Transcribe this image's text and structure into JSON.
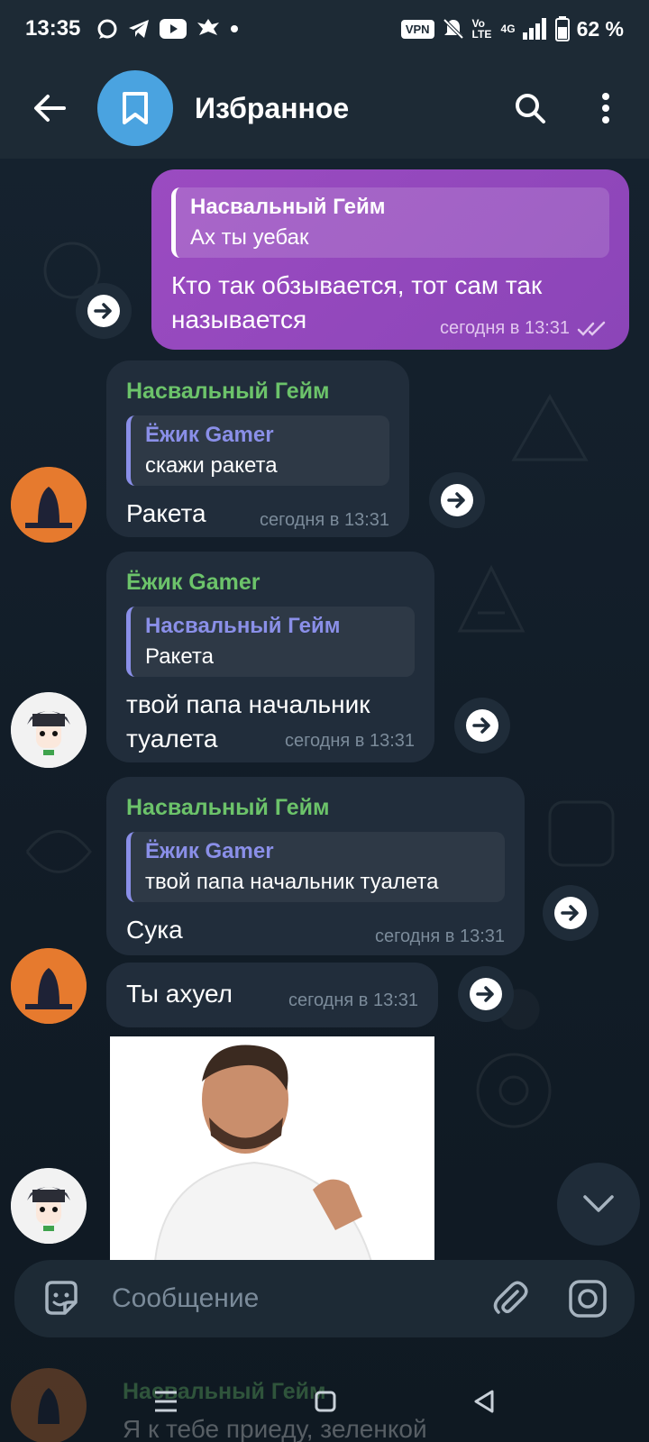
{
  "status_bar": {
    "time": "13:35",
    "vpn_label": "VPN",
    "volte_label": "Vo LTE",
    "network_label": "4G",
    "battery": "62 %"
  },
  "header": {
    "title": "Избранное"
  },
  "messages": [
    {
      "direction": "out",
      "reply_name": "Насвальный Гейм",
      "reply_text": "Ах ты уебак",
      "text": "Кто так обзывается, тот сам так называется",
      "time": "сегодня в 13:31"
    },
    {
      "direction": "in",
      "sender": "Насвальный Гейм",
      "reply_name": "Ёжик Gamer",
      "reply_text": "скажи ракета",
      "text": "Ракета",
      "time": "сегодня в 13:31"
    },
    {
      "direction": "in",
      "sender": "Ёжик Gamer",
      "reply_name": "Насвальный Гейм",
      "reply_text": "Ракета",
      "text": "твой папа начальник туалета",
      "time": "сегодня в 13:31"
    },
    {
      "direction": "in",
      "sender": "Насвальный Гейм",
      "reply_name": "Ёжик Gamer",
      "reply_text": "твой папа начальник туалета",
      "text": "Сука",
      "time": "сегодня в 13:31"
    },
    {
      "direction": "in",
      "text": "Ты ахуел",
      "time": "сегодня в 13:31"
    }
  ],
  "composer": {
    "placeholder": "Сообщение"
  },
  "preview": {
    "sender": "Насвальный Гейм",
    "text": "Я к тебе приеду, зеленкой"
  },
  "colors": {
    "accent_out": "#9b4bc1",
    "sender_green": "#6cc36a",
    "reply_purple": "#8a8fe8",
    "bubble_in": "#212d3b"
  }
}
